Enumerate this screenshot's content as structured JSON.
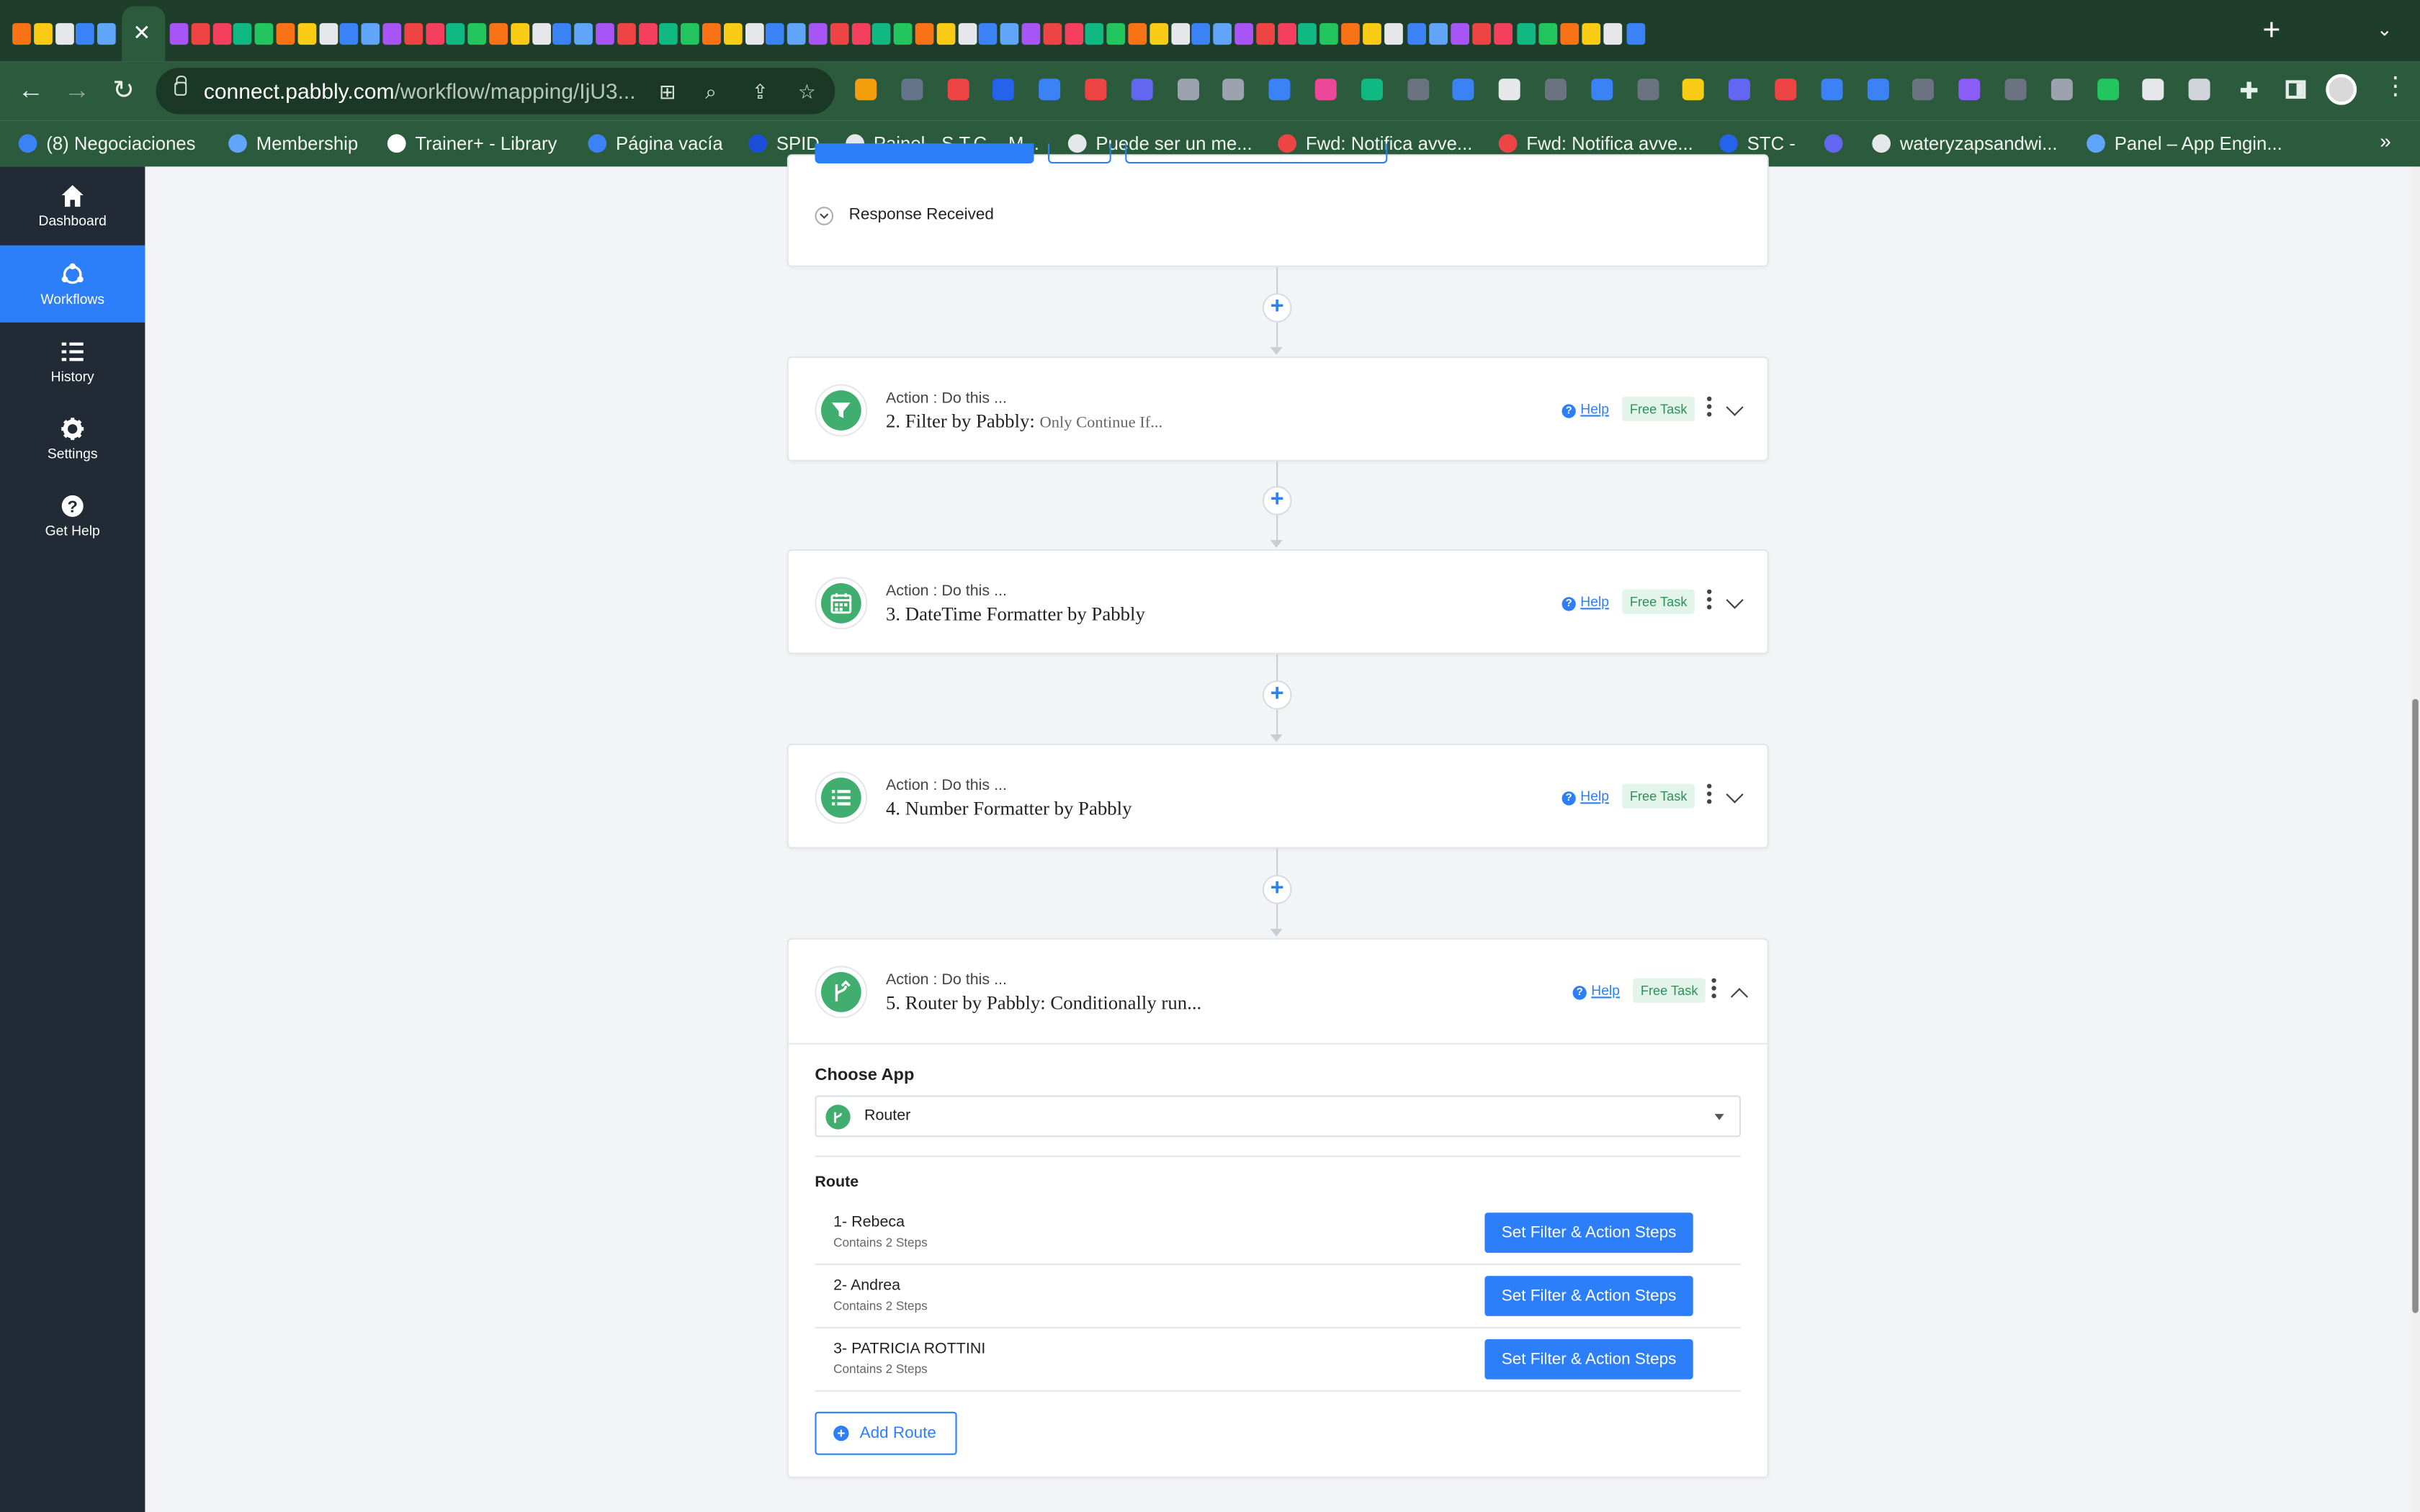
{
  "browser": {
    "active_tab_close": "✕",
    "new_tab": "+",
    "url_host": "connect.pabbly.com",
    "url_path": "/workflow/mapping/IjU3...",
    "bookmarks": [
      {
        "label": "(8) Negociaciones",
        "color": "#3b82f6"
      },
      {
        "label": "Membership",
        "color": "#60a5fa"
      },
      {
        "label": "Trainer+ - Library",
        "color": "#ffffff"
      },
      {
        "label": "Página vacía",
        "color": "#3b82f6"
      },
      {
        "label": "SPID",
        "color": "#1d4ed8"
      },
      {
        "label": "Painel - S.T.C. - M...",
        "color": "#e5e7eb"
      },
      {
        "label": "Puede ser un me...",
        "color": "#e5e7eb"
      },
      {
        "label": "Fwd: Notifica avve...",
        "color": "#ef4444"
      },
      {
        "label": "Fwd: Notifica avve...",
        "color": "#ef4444"
      },
      {
        "label": "STC -",
        "color": "#2563eb"
      },
      {
        "label": "",
        "color": "#6366f1"
      },
      {
        "label": "wateryzapsandwi...",
        "color": "#e5e7eb"
      },
      {
        "label": "Panel – App Engin...",
        "color": "#60a5fa"
      }
    ]
  },
  "sidebar": {
    "items": [
      {
        "label": "Dashboard",
        "icon": "home-icon"
      },
      {
        "label": "Workflows",
        "icon": "workflows-icon"
      },
      {
        "label": "History",
        "icon": "history-icon"
      },
      {
        "label": "Settings",
        "icon": "gear-icon"
      },
      {
        "label": "Get Help",
        "icon": "question-icon"
      }
    ]
  },
  "trigger": {
    "response_label": "Response Received"
  },
  "steps": [
    {
      "sub": "Action : Do this ...",
      "title": "2. Filter by Pabbly:",
      "desc": "Only Continue If...",
      "help": "Help",
      "badge": "Free Task",
      "icon": "filter-icon"
    },
    {
      "sub": "Action : Do this ...",
      "title": "3. DateTime Formatter by Pabbly",
      "desc": "",
      "help": "Help",
      "badge": "Free Task",
      "icon": "calendar-icon"
    },
    {
      "sub": "Action : Do this ...",
      "title": "4. Number Formatter by Pabbly",
      "desc": "",
      "help": "Help",
      "badge": "Free Task",
      "icon": "list-icon"
    },
    {
      "sub": "Action : Do this ...",
      "title": "5. Router by Pabbly: Conditionally run...",
      "desc": "",
      "help": "Help",
      "badge": "Free Task",
      "icon": "router-icon"
    }
  ],
  "router": {
    "choose_app_label": "Choose App",
    "selected_app": "Router",
    "route_label": "Route",
    "routes": [
      {
        "name": "1- Rebeca",
        "steps": "Contains 2 Steps",
        "button": "Set Filter & Action Steps"
      },
      {
        "name": "2- Andrea",
        "steps": "Contains 2 Steps",
        "button": "Set Filter & Action Steps"
      },
      {
        "name": "3- PATRICIA ROTTINI",
        "steps": "Contains 2 Steps",
        "button": "Set Filter & Action Steps"
      }
    ],
    "add_route_label": "Add Route"
  },
  "colors": {
    "accent": "#2d7ff9",
    "step_icon": "#3fae6f",
    "sidebar": "#222b35",
    "browser_chrome": "#2b5a3d"
  }
}
